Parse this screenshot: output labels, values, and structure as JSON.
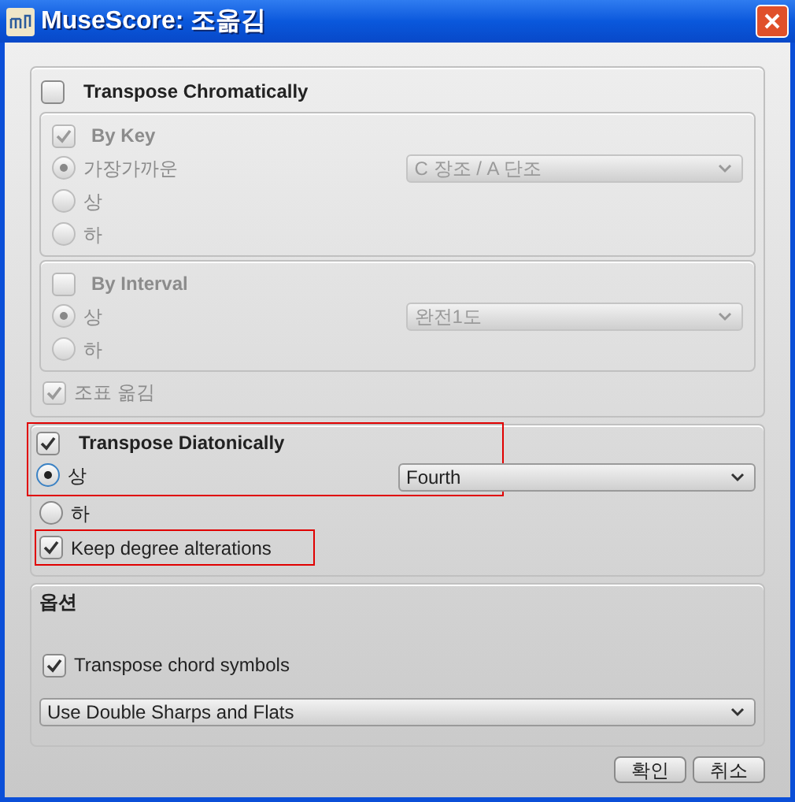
{
  "window": {
    "title": "MuseScore: 조옮김"
  },
  "chromatic": {
    "label": "Transpose Chromatically",
    "checked": false,
    "by_key": {
      "label": "By Key",
      "checked": true,
      "select": "C 장조 / A 단조",
      "options": [
        {
          "label": "가장가까운",
          "selected": true
        },
        {
          "label": "상",
          "selected": false
        },
        {
          "label": "하",
          "selected": false
        }
      ]
    },
    "by_interval": {
      "label": "By Interval",
      "checked": false,
      "select": "완전1도",
      "options": [
        {
          "label": "상",
          "selected": true
        },
        {
          "label": "하",
          "selected": false
        }
      ]
    },
    "transpose_key": {
      "label": "조표 옮김",
      "checked": true
    }
  },
  "diatonic": {
    "label": "Transpose Diatonically",
    "checked": true,
    "highlighted": true,
    "select": "Fourth",
    "options": [
      {
        "label": "상",
        "selected": true
      },
      {
        "label": "하",
        "selected": false
      }
    ],
    "keep_degree": {
      "label": "Keep degree alterations",
      "checked": true,
      "highlighted": true
    }
  },
  "options": {
    "title": "옵션",
    "chord_symbols": {
      "label": "Transpose chord symbols",
      "checked": true
    },
    "select": "Use Double Sharps and Flats"
  },
  "buttons": [
    "확인",
    "취소"
  ]
}
